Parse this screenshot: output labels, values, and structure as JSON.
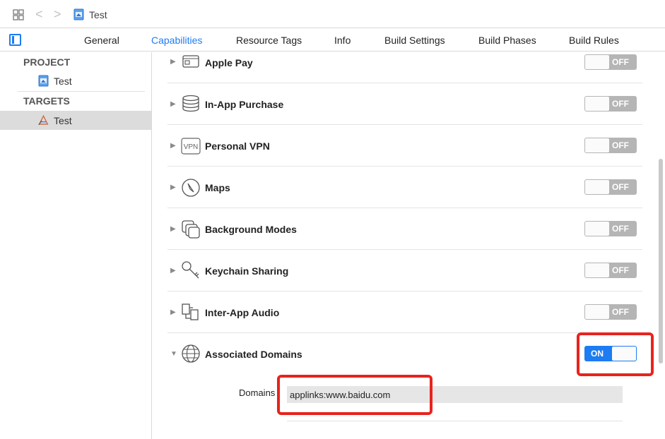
{
  "toolbar": {
    "back_glyph": "<",
    "forward_glyph": ">",
    "breadcrumb": "Test"
  },
  "tabs": [
    {
      "label": "General",
      "active": false
    },
    {
      "label": "Capabilities",
      "active": true
    },
    {
      "label": "Resource Tags",
      "active": false
    },
    {
      "label": "Info",
      "active": false
    },
    {
      "label": "Build Settings",
      "active": false
    },
    {
      "label": "Build Phases",
      "active": false
    },
    {
      "label": "Build Rules",
      "active": false
    }
  ],
  "sidebar": {
    "project_header": "PROJECT",
    "project_item": "Test",
    "targets_header": "TARGETS",
    "target_item": "Test"
  },
  "capabilities": [
    {
      "label": "Apple Pay",
      "icon": "apple-pay-card-icon",
      "state": "OFF"
    },
    {
      "label": "In-App Purchase",
      "icon": "coin-stack-icon",
      "state": "OFF"
    },
    {
      "label": "Personal VPN",
      "icon": "vpn-icon",
      "state": "OFF"
    },
    {
      "label": "Maps",
      "icon": "compass-icon",
      "state": "OFF"
    },
    {
      "label": "Background Modes",
      "icon": "stacked-squares-icon",
      "state": "OFF"
    },
    {
      "label": "Keychain Sharing",
      "icon": "key-icon",
      "state": "OFF"
    },
    {
      "label": "Inter-App Audio",
      "icon": "audio-plug-icon",
      "state": "OFF"
    },
    {
      "label": "Associated Domains",
      "icon": "globe-icon",
      "state": "ON",
      "expanded": true
    }
  ],
  "associated_domains": {
    "label": "Domains",
    "value": "applinks:www.baidu.com"
  },
  "colors": {
    "accent": "#1d7cf2",
    "highlight": "#e8231e",
    "toggle_off": "#b5b5b5"
  }
}
